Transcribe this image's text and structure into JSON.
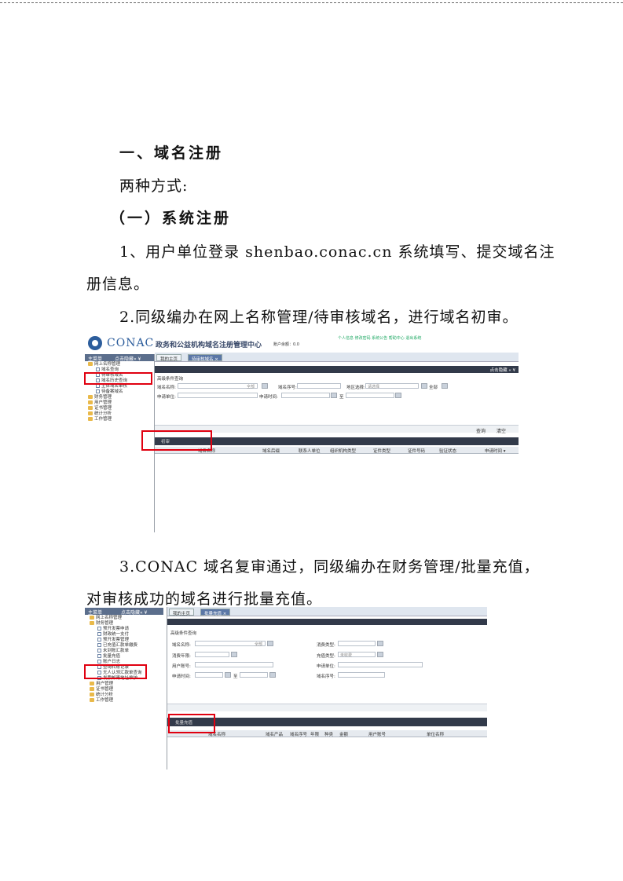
{
  "document": {
    "heading1": "一、域名注册",
    "intro": "两种方式:",
    "heading2": "（一）系统注册",
    "step1_line1": "1、用户单位登录 shenbao.conac.cn 系统填写、提交域名注",
    "step1_line2": "册信息。",
    "step2": "2.同级编办在网上名称管理/待审核域名，进行域名初审。",
    "step3_line1": "3.CONAC 域名复审通过，同级编办在财务管理/批量充值，",
    "step3_line2": "对审核成功的域名进行批量充值。"
  },
  "screenshot1": {
    "logo_text": "CONAC",
    "site_title": "政务和公益机构域名注册管理中心",
    "user_info": "账户余额：0.0",
    "nav_links": "个人信息  修改密码  系统公告  帮助中心  退出系统",
    "sidebar_title": "主菜单",
    "sidebar_toggle": "点击隐藏« ¥",
    "tree": [
      "网上名称管理",
      "域名查询",
      "待审核域名",
      "域名历史查询",
      "主体域名审核",
      "待备案域名",
      "财务管理",
      "用户管理",
      "证书管理",
      "统计分析",
      "工作管理"
    ],
    "tabs": [
      "我的主页",
      "待审核域名 ×"
    ],
    "panel_toggle": "点击隐藏 «  ¥",
    "query_title": "高级条件查询",
    "labels": {
      "domain": "域名名称:",
      "serial": "域名序号:",
      "region": "地区选择:",
      "applicant": "申请单位:",
      "apply_time": "申请时间:",
      "to": "至"
    },
    "placeholders": {
      "all": "全部",
      "please_select": "请选择"
    },
    "buttons": {
      "query": "查询",
      "clear": "清空",
      "review": "初审"
    },
    "columns": [
      "域名名称",
      "域名后缀",
      "联系人单位",
      "组织机构类型",
      "证件类型",
      "证件号码",
      "验证状态",
      "申请时间 ▾"
    ]
  },
  "screenshot2": {
    "sidebar_title": "主菜单",
    "sidebar_toggle": "点击隐藏« ¥",
    "tree": [
      "网上名称管理",
      "财务管理",
      "预开发票申请",
      "财政统一支付",
      "预开发票管理",
      "已充值汇款单缴费",
      "未到账汇款单",
      "批量充值",
      "账户日志",
      "查询转账记录",
      "无人认领汇款单查询",
      "发票邮寄地址维护",
      "用户管理",
      "证书管理",
      "统计分析",
      "工作管理"
    ],
    "tabs": [
      "我的主页",
      "批量充值 ×"
    ],
    "query_title": "高级条件查询",
    "labels": {
      "domain": "域名名称:",
      "consume_type": "消费类型:",
      "consume_years": "消费年限:",
      "charge_type": "充值类型:",
      "user_account": "用户账号:",
      "applicant": "申请单位:",
      "apply_time": "申请时间:",
      "serial": "域名序号:",
      "to": "至"
    },
    "placeholders": {
      "all": "全部",
      "not_charged": "未收费"
    },
    "buttons": {
      "batch": "批量充值"
    },
    "columns": [
      "域名名称",
      "域名产品",
      "域名序号",
      "年限",
      "种类",
      "金额",
      "用户账号",
      "单位名称"
    ]
  }
}
